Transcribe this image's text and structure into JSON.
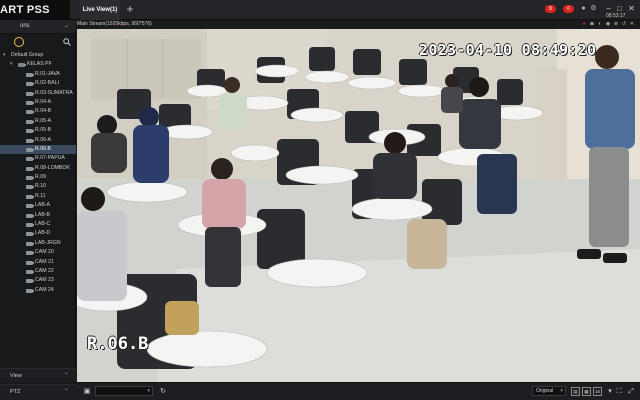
{
  "app": {
    "title": "ART PSS"
  },
  "tabs": [
    {
      "label": "Live View(1)"
    }
  ],
  "topbar_right": {
    "badge_1": "8",
    "badge_2": "6",
    "clock_time": "08:53:17"
  },
  "sidebar": {
    "header_label": "ons",
    "tree": {
      "root": "Default Group",
      "group": "KELAS PF",
      "items": [
        "R.01-JAVA",
        "R.02-BALI",
        "R.03-SUMATRA",
        "R.04-A",
        "R.04-B",
        "R.05-A",
        "R.05-B",
        "R.06-A",
        "R.06.B",
        "R.07-PAPUA",
        "R.08-LOMBOK",
        "R.09",
        "R.10",
        "R.11",
        "LAB-A",
        "LAB-B",
        "LAB-C",
        "LAB-D",
        "LAB-JRGN",
        "CAM 20",
        "CAM 21",
        "CAM 22",
        "CAM 23",
        "CAM 24"
      ],
      "selected": "R.06.B"
    },
    "bottom_sections": [
      "View",
      "PTZ"
    ]
  },
  "video": {
    "stream_label": "Main Stream(1920kbps, 960*576)",
    "osd_timestamp": "2023-04-10  08:49:20",
    "osd_channel_name": "R.06.B"
  },
  "bottombar": {
    "stream_select": "",
    "scale_select": "Original"
  },
  "colors": {
    "accent_red": "#d9231d",
    "selection": "#3b4a5e",
    "toolbar_bg": "#232427",
    "sidebar_bg": "#18191b"
  }
}
